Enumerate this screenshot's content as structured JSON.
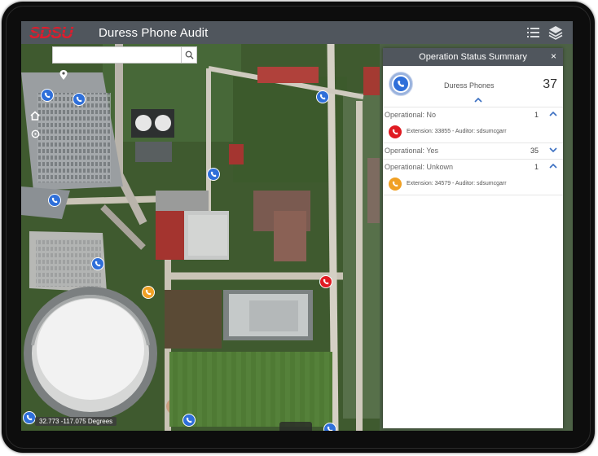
{
  "app": {
    "title": "Duress Phone Audit",
    "logo_text": "SDSU"
  },
  "header": {
    "buttons": [
      "list-icon",
      "layers-icon"
    ]
  },
  "map": {
    "search_placeholder": "",
    "coordinates": "32.773 -117.075 Degrees",
    "tools": [
      "locate-icon",
      "home-icon",
      "my-location-icon"
    ]
  },
  "panel": {
    "title": "Operation Status Summary",
    "close_label": "×",
    "summary": {
      "label": "Duress Phones",
      "count": "37"
    },
    "collapse_label": "^",
    "groups": [
      {
        "label": "Operational: No",
        "count": "1",
        "expanded": true,
        "features": [
          {
            "text": "Extension: 33855 - Auditor: sdsumcgarr",
            "color": "#e01b22"
          }
        ]
      },
      {
        "label": "Operational: Yes",
        "count": "35",
        "expanded": false,
        "features": []
      },
      {
        "label": "Operational: Unkown",
        "count": "1",
        "expanded": true,
        "features": [
          {
            "text": "Extension: 34579 - Auditor: sdsumcgarr",
            "color": "#f0a024"
          }
        ]
      }
    ]
  },
  "colors": {
    "header": "#50565d",
    "brand_red": "#e21b2c",
    "phone_blue": "#2f6fd9",
    "status_no": "#e01b22",
    "status_unknown": "#f0a024",
    "accent": "#3b6fc1"
  }
}
